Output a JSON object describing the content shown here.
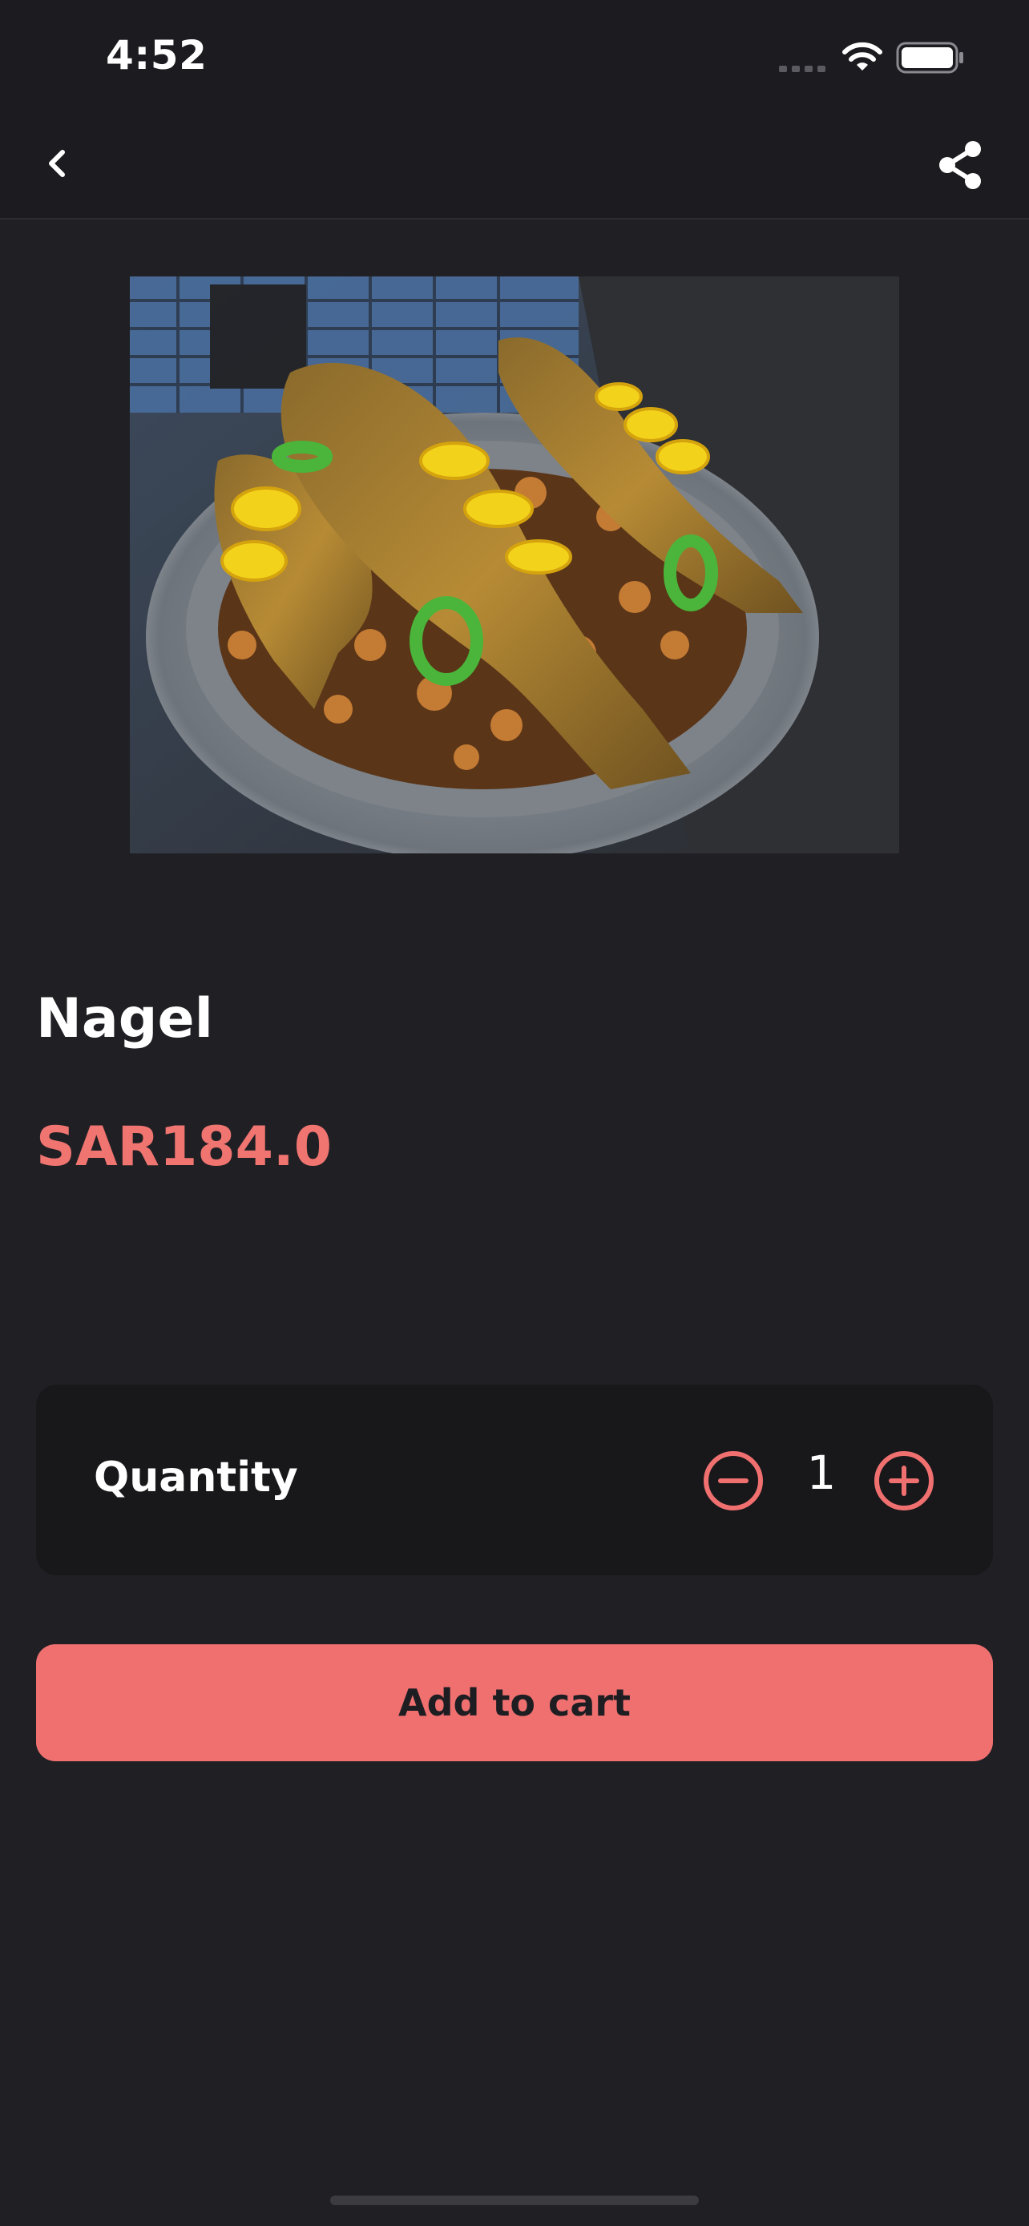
{
  "status_bar": {
    "time": "4:52",
    "icons": [
      "signal-icon",
      "wifi-icon",
      "battery-icon"
    ]
  },
  "nav": {
    "back_icon": "chevron-left-icon",
    "share_icon": "share-icon"
  },
  "product": {
    "image_icon": "photo of fried fish on rice platter",
    "name": "Nagel",
    "price": "SAR184.0"
  },
  "quantity": {
    "label": "Quantity",
    "value": "1",
    "minus_icon": "minus-circle-icon",
    "plus_icon": "plus-circle-icon"
  },
  "cart": {
    "button_label": "Add to cart"
  },
  "colors": {
    "background": "#202024",
    "bar": "#1c1c20",
    "card": "#18181b",
    "accent": "#f07070",
    "text": "#ffffff"
  }
}
